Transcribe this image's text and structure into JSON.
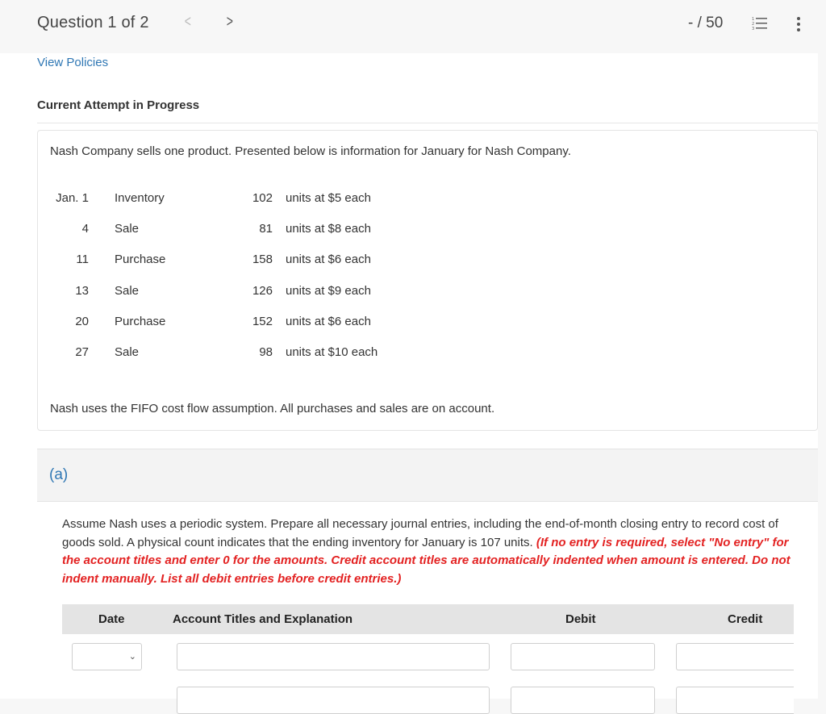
{
  "header": {
    "question_label": "Question 1 of 2",
    "prev_icon": "chevron-left-icon",
    "next_icon": "chevron-right-icon",
    "score": "- / 50",
    "list_icon": "numbered-list-icon",
    "more_icon": "more-vertical-icon"
  },
  "links": {
    "view_policies": "View Policies"
  },
  "attempt_status": "Current Attempt in Progress",
  "problem": {
    "intro": "Nash Company sells one product. Presented below is information for January for Nash Company.",
    "transactions": [
      {
        "date": "Jan. 1",
        "type": "Inventory",
        "units": "102",
        "desc": "units at $5 each"
      },
      {
        "date": "4",
        "type": "Sale",
        "units": "81",
        "desc": "units at $8 each"
      },
      {
        "date": "11",
        "type": "Purchase",
        "units": "158",
        "desc": "units at $6 each"
      },
      {
        "date": "13",
        "type": "Sale",
        "units": "126",
        "desc": "units at $9 each"
      },
      {
        "date": "20",
        "type": "Purchase",
        "units": "152",
        "desc": "units at $6 each"
      },
      {
        "date": "27",
        "type": "Sale",
        "units": "98",
        "desc": "units at $10 each"
      }
    ],
    "assumption": "Nash uses the FIFO cost flow assumption. All purchases and sales are on account."
  },
  "part_a": {
    "label": "(a)",
    "instructions": "Assume Nash uses a periodic system. Prepare all necessary journal entries, including the end-of-month closing entry to record cost of goods sold. A physical count indicates that the ending inventory for January is 107 units.",
    "warning": "(If no entry is required, select \"No entry\" for the account titles and enter 0 for the amounts. Credit account titles are automatically indented when amount is entered. Do not indent manually. List all debit entries before credit entries.)",
    "journal": {
      "columns": [
        "Date",
        "Account Titles and Explanation",
        "Debit",
        "Credit"
      ],
      "rows": [
        {
          "date": "",
          "account": "",
          "debit": "",
          "credit": ""
        },
        {
          "account": "",
          "debit": "",
          "credit": ""
        }
      ]
    }
  },
  "colors": {
    "link": "#2f77b4",
    "warning": "#e32222",
    "header_bg": "#e4e4e4",
    "part_bg": "#f3f3f3"
  }
}
